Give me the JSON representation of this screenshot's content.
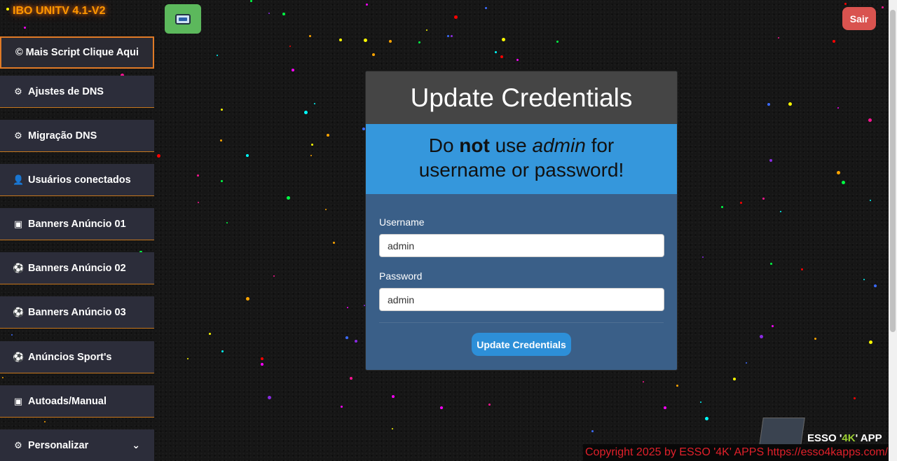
{
  "brand": "IBO UNITV 4.1-V2",
  "header": {
    "exit_label": "Sair"
  },
  "sidebar": {
    "items": [
      {
        "label": "© Mais Script Clique Aqui",
        "icon": ""
      },
      {
        "label": "Ajustes de DNS",
        "icon": "gears-icon"
      },
      {
        "label": "Migração DNS",
        "icon": "gears-icon"
      },
      {
        "label": "Usuários conectados",
        "icon": "user-icon"
      },
      {
        "label": "Banners Anúncio 01",
        "icon": "image-icon"
      },
      {
        "label": "Banners Anúncio 02",
        "icon": "soccer-ball-icon"
      },
      {
        "label": "Banners Anúncio 03",
        "icon": "soccer-ball-icon"
      },
      {
        "label": "Anúncios Sport's",
        "icon": "soccer-ball-icon"
      },
      {
        "label": "Autoads/Manual",
        "icon": "image-icon"
      },
      {
        "label": "Personalizar",
        "icon": "gears-icon"
      }
    ]
  },
  "card": {
    "title": "Update Credentials",
    "warning": {
      "part1": "Do ",
      "bold": "not",
      "part2": " use ",
      "italic": "admin",
      "part3": " for",
      "line2": "username or password!"
    },
    "username_label": "Username",
    "username_value": "admin",
    "password_label": "Password",
    "password_value": "admin",
    "submit_label": "Update Credentials"
  },
  "promo": {
    "prefix": "ESSO '",
    "highlight": "4K",
    "suffix": "' APP"
  },
  "footer": {
    "text": "Copyright 2025  by ESSO '4K' APPS https://esso4kapps.com/"
  },
  "colors": {
    "brand": "#ff9800",
    "exit": "#d9534f",
    "logo_button": "#5cb85c",
    "sidebar_accent": "#e07a26",
    "warning_bg": "#3597dc",
    "form_bg": "#3a5f88",
    "submit": "#2d8fd8",
    "footer_text": "#e0202a"
  }
}
